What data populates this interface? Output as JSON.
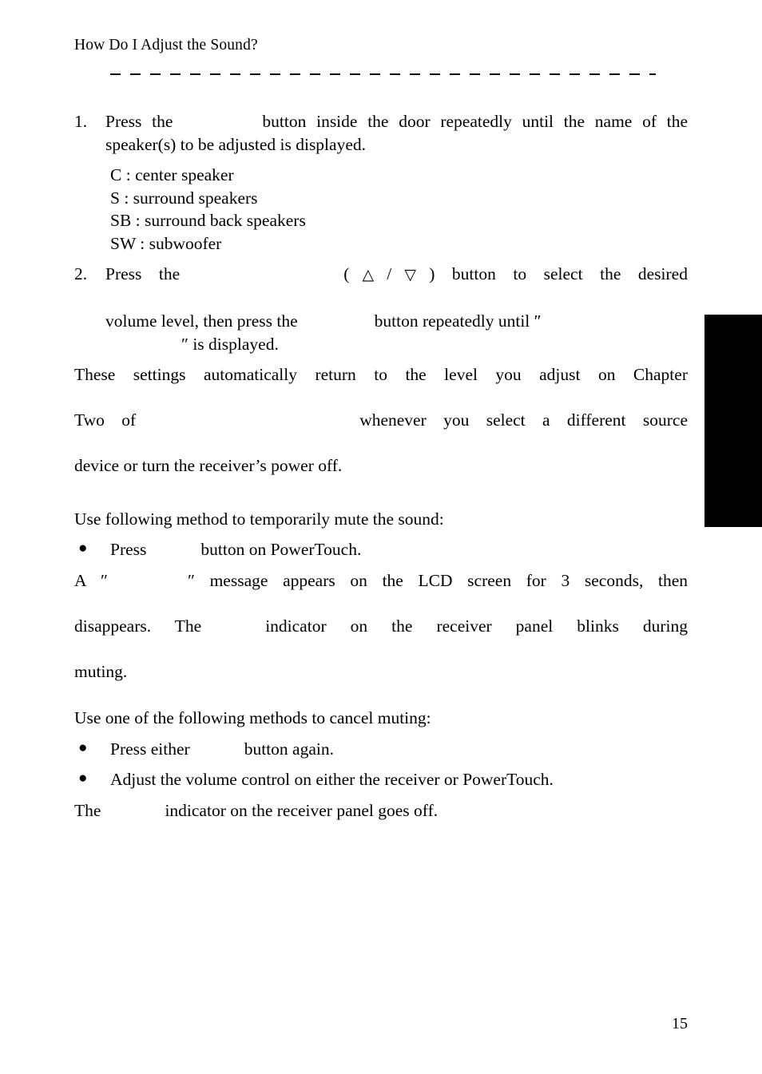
{
  "page": {
    "running_header": "How Do I Adjust the Sound?",
    "folio": "15",
    "thumb_index_color": "#000000",
    "background_color": "#ffffff",
    "text_color": "#000000"
  },
  "steps": [
    {
      "marker": "1.",
      "text_before": "Press the",
      "text_after": "button inside the door repeatedly until the name of the speaker(s) to be adjusted is displayed."
    },
    {
      "marker": "2.",
      "line1_before": "Press  the",
      "triangle_up": "△",
      "triangle_separator": "/",
      "triangle_down": "▽",
      "line1_after": ")  button  to  select  the  desired",
      "line2_before": "volume level, then press the",
      "line2_after": "button repeatedly until ″",
      "line3_after": "″ is displayed."
    }
  ],
  "speaker_legend": [
    "C : center speaker",
    "S : surround speakers",
    "SB : surround back speakers",
    "SW : subwoofer"
  ],
  "note": {
    "line1": "These  settings  automatically  return  to  the  level  you  adjust  on  Chapter",
    "line2_before": "Two of",
    "line2_after": "whenever you select a different source",
    "line3": "device or turn the receiver’s power off."
  },
  "mute_section": {
    "intro": "Use following method to temporarily mute the sound:",
    "bullet": {
      "before": "Press",
      "after": "button on PowerTouch."
    },
    "result": {
      "line1_before": "A ″",
      "line1_after": "″  message  appears  on  the  LCD  screen  for  3  seconds,  then",
      "line2_before": "disappears. The",
      "line2_after": "indicator  on  the  receiver  panel  blinks  during",
      "line3": "muting."
    }
  },
  "cancel_section": {
    "intro": "Use one of the following methods to cancel muting:",
    "bullets": [
      {
        "before": "Press either",
        "after": "button again."
      },
      {
        "before": "Adjust the volume control on either the receiver or PowerTouch.",
        "after": ""
      }
    ],
    "result": {
      "before": "The",
      "after": "indicator on the receiver panel goes off."
    }
  }
}
